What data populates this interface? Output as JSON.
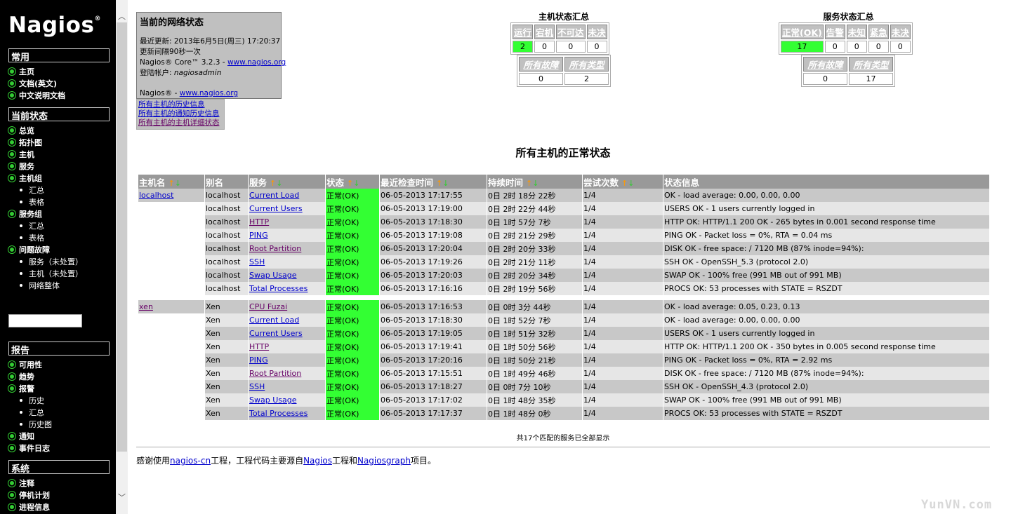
{
  "sidebar": {
    "logo": "Nagios",
    "logo_mark": "®",
    "sections": {
      "common": "常用",
      "current": "当前状态",
      "reports": "报告",
      "system": "系统"
    },
    "common_items": [
      "主页",
      "文档(英文)",
      "中文说明文档"
    ],
    "current_items": {
      "overview": "总览",
      "map": "拓扑图",
      "hosts": "主机",
      "services": "服务",
      "hostgroups": "主机组",
      "hostgroups_sub": [
        "汇总",
        "表格"
      ],
      "servicegroups": "服务组",
      "servicegroups_sub": [
        "汇总",
        "表格"
      ],
      "problems": "问题故障",
      "problems_sub": [
        "服务（未处置）",
        "主机（未处置）",
        "网络整体"
      ]
    },
    "report_items": {
      "availability": "可用性",
      "trends": "趋势",
      "alerts": "报警",
      "alerts_sub": [
        "历史",
        "汇总",
        "历史图"
      ],
      "notifications": "通知",
      "eventlog": "事件日志"
    },
    "system_items": [
      "注释",
      "停机计划",
      "进程信息"
    ]
  },
  "status_box": {
    "title": "当前的网络状态",
    "last_update": "最近更新: 2013年6月5日(周三) 17:20:37",
    "interval": "更新间隔90秒一次",
    "version_prefix": "Nagios® Core™ 3.2.3 - ",
    "version_link": "www.nagios.org",
    "login": "登陆帐户: ",
    "user": "nagiosadmin",
    "footer_prefix": "Nagios® - ",
    "footer_link": "www.nagios.org"
  },
  "links": [
    "所有主机的历史信息",
    "所有主机的通知历史信息",
    "所有主机的主机详细状态"
  ],
  "host_summary": {
    "title": "主机状态汇总",
    "headers": [
      "运行",
      "宕机",
      "不可达",
      "未决"
    ],
    "values": [
      "2",
      "0",
      "0",
      "0"
    ],
    "totals_headers": [
      "所有故障",
      "所有类型"
    ],
    "totals_values": [
      "0",
      "2"
    ]
  },
  "service_summary": {
    "title": "服务状态汇总",
    "headers": [
      "正常(OK)",
      "告警",
      "未知",
      "紧急",
      "未决"
    ],
    "values": [
      "17",
      "0",
      "0",
      "0",
      "0"
    ],
    "totals_headers": [
      "所有故障",
      "所有类型"
    ],
    "totals_values": [
      "0",
      "17"
    ]
  },
  "main_title": "所有主机的正常状态",
  "table": {
    "columns": [
      "主机名",
      "别名",
      "服务",
      "状态",
      "最近检查时间",
      "持续时间",
      "尝试次数",
      "状态信息"
    ],
    "sort_up": "↑",
    "sort_down": "↓",
    "groups": [
      {
        "host": "localhost",
        "rows": [
          [
            "localhost",
            "Current Load",
            "正常(OK)",
            "06-05-2013 17:17:55",
            "0日  2时  18分  22秒",
            "1/4",
            "OK - load average: 0.00, 0.00, 0.00"
          ],
          [
            "localhost",
            "Current Users",
            "正常(OK)",
            "06-05-2013 17:19:00",
            "0日  2时  22分  44秒",
            "1/4",
            "USERS OK - 1 users currently logged in"
          ],
          [
            "localhost",
            "HTTP",
            "正常(OK)",
            "06-05-2013 17:18:30",
            "0日  1时  57分  7秒",
            "1/4",
            "HTTP OK: HTTP/1.1 200 OK - 265 bytes in 0.001 second response time"
          ],
          [
            "localhost",
            "PING",
            "正常(OK)",
            "06-05-2013 17:19:08",
            "0日  2时  21分  29秒",
            "1/4",
            "PING OK - Packet loss = 0%, RTA = 0.04 ms"
          ],
          [
            "localhost",
            "Root Partition",
            "正常(OK)",
            "06-05-2013 17:20:04",
            "0日  2时  20分  33秒",
            "1/4",
            "DISK OK - free space: / 7120 MB (87% inode=94%):"
          ],
          [
            "localhost",
            "SSH",
            "正常(OK)",
            "06-05-2013 17:19:26",
            "0日  2时  21分  11秒",
            "1/4",
            "SSH OK - OpenSSH_5.3 (protocol 2.0)"
          ],
          [
            "localhost",
            "Swap Usage",
            "正常(OK)",
            "06-05-2013 17:20:03",
            "0日  2时  20分  34秒",
            "1/4",
            "SWAP OK - 100% free (991 MB out of 991 MB)"
          ],
          [
            "localhost",
            "Total Processes",
            "正常(OK)",
            "06-05-2013 17:16:16",
            "0日  2时  19分  56秒",
            "1/4",
            "PROCS OK: 53 processes with STATE = RSZDT"
          ]
        ]
      },
      {
        "host": "xen",
        "rows": [
          [
            "Xen",
            "CPU Fuzai",
            "正常(OK)",
            "06-05-2013 17:16:53",
            "0日  0时  3分  44秒",
            "1/4",
            "OK - load average: 0.05, 0.23, 0.13"
          ],
          [
            "Xen",
            "Current Load",
            "正常(OK)",
            "06-05-2013 17:18:30",
            "0日  1时  52分  7秒",
            "1/4",
            "OK - load average: 0.00, 0.00, 0.00"
          ],
          [
            "Xen",
            "Current Users",
            "正常(OK)",
            "06-05-2013 17:19:05",
            "0日  1时  51分  32秒",
            "1/4",
            "USERS OK - 1 users currently logged in"
          ],
          [
            "Xen",
            "HTTP",
            "正常(OK)",
            "06-05-2013 17:19:41",
            "0日  1时  50分  56秒",
            "1/4",
            "HTTP OK: HTTP/1.1 200 OK - 350 bytes in 0.005 second response time"
          ],
          [
            "Xen",
            "PING",
            "正常(OK)",
            "06-05-2013 17:20:16",
            "0日  1时  50分  21秒",
            "1/4",
            "PING OK - Packet loss = 0%, RTA = 2.92 ms"
          ],
          [
            "Xen",
            "Root Partition",
            "正常(OK)",
            "06-05-2013 17:15:51",
            "0日  1时  49分  46秒",
            "1/4",
            "DISK OK - free space: / 7120 MB (87% inode=94%):"
          ],
          [
            "Xen",
            "SSH",
            "正常(OK)",
            "06-05-2013 17:18:27",
            "0日  0时  7分  10秒",
            "1/4",
            "SSH OK - OpenSSH_4.3 (protocol 2.0)"
          ],
          [
            "Xen",
            "Swap Usage",
            "正常(OK)",
            "06-05-2013 17:17:02",
            "0日  1时  48分  35秒",
            "1/4",
            "SWAP OK - 100% free (991 MB out of 991 MB)"
          ],
          [
            "Xen",
            "Total Processes",
            "正常(OK)",
            "06-05-2013 17:17:37",
            "0日  1时  48分  0秒",
            "1/4",
            "PROCS OK: 53 processes with STATE = RSZDT"
          ]
        ]
      }
    ]
  },
  "footer_count": "共17个匹配的服务已全部显示",
  "thanks": {
    "t1": "感谢使用",
    "l1": "nagios-cn",
    "t2": "工程，工程代码主要源自",
    "l2": "Nagios",
    "t3": "工程和",
    "l3": "Nagiosgraph",
    "t4": "项目。"
  },
  "watermark": "YunVN.com",
  "colors": {
    "ok_green": "#33ff33",
    "header_gray": "#999999",
    "sidebar_bg": "#000000",
    "bullet_green": "#33cc33"
  }
}
